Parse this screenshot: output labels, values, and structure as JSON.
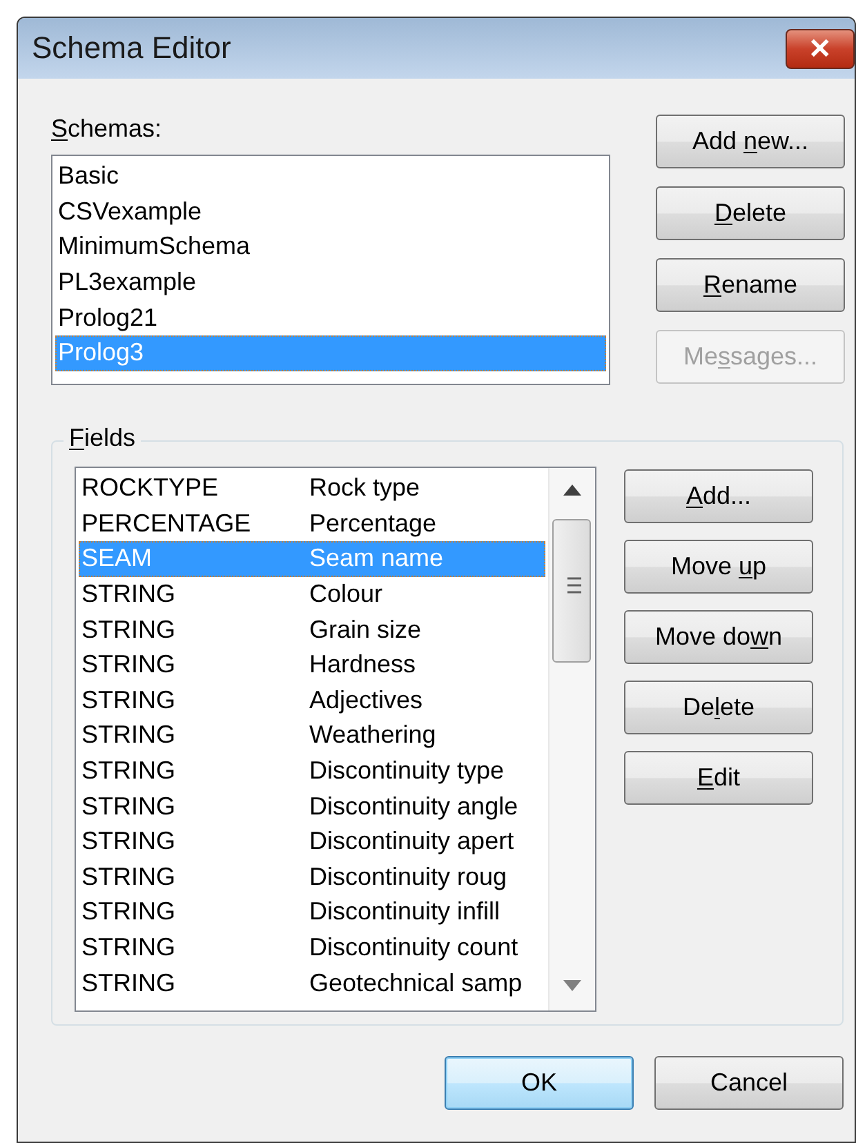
{
  "window": {
    "title": "Schema Editor",
    "close": "✕"
  },
  "schemas": {
    "label": {
      "key": "S",
      "post": "chemas:"
    },
    "items": [
      {
        "name": "Basic",
        "selected": false
      },
      {
        "name": "CSVexample",
        "selected": false
      },
      {
        "name": "MinimumSchema",
        "selected": false
      },
      {
        "name": "PL3example",
        "selected": false
      },
      {
        "name": "Prolog21",
        "selected": false
      },
      {
        "name": "Prolog3",
        "selected": true
      }
    ],
    "buttons": [
      {
        "pre": "Add ",
        "key": "n",
        "post": "ew...",
        "disabled": false
      },
      {
        "key": "D",
        "post": "elete",
        "disabled": false
      },
      {
        "key": "R",
        "post": "ename",
        "disabled": false
      },
      {
        "pre": "Me",
        "key": "s",
        "post": "sages...",
        "disabled": true
      }
    ]
  },
  "fields": {
    "label": {
      "key": "F",
      "post": "ields"
    },
    "rows": [
      {
        "type": "ROCKTYPE",
        "name": "Rock type",
        "selected": false
      },
      {
        "type": "PERCENTAGE",
        "name": "Percentage",
        "selected": false
      },
      {
        "type": "SEAM",
        "name": "Seam name",
        "selected": true
      },
      {
        "type": "STRING",
        "name": "Colour",
        "selected": false
      },
      {
        "type": "STRING",
        "name": "Grain size",
        "selected": false
      },
      {
        "type": "STRING",
        "name": "Hardness",
        "selected": false
      },
      {
        "type": "STRING",
        "name": "Adjectives",
        "selected": false
      },
      {
        "type": "STRING",
        "name": "Weathering",
        "selected": false
      },
      {
        "type": "STRING",
        "name": "Discontinuity type",
        "selected": false
      },
      {
        "type": "STRING",
        "name": "Discontinuity angle",
        "selected": false
      },
      {
        "type": "STRING",
        "name": "Discontinuity apert",
        "selected": false
      },
      {
        "type": "STRING",
        "name": "Discontinuity roug",
        "selected": false
      },
      {
        "type": "STRING",
        "name": "Discontinuity infill",
        "selected": false
      },
      {
        "type": "STRING",
        "name": "Discontinuity count",
        "selected": false
      },
      {
        "type": "STRING",
        "name": "Geotechnical samp",
        "selected": false
      }
    ],
    "buttons": [
      {
        "key": "A",
        "post": "dd...",
        "disabled": false
      },
      {
        "pre": "Move ",
        "key": "u",
        "post": "p",
        "disabled": false
      },
      {
        "pre": "Move do",
        "key": "w",
        "post": "n",
        "disabled": false
      },
      {
        "pre": "De",
        "key": "l",
        "post": "ete",
        "disabled": false
      },
      {
        "key": "E",
        "post": "dit",
        "disabled": false
      }
    ]
  },
  "footer": [
    {
      "label": "OK",
      "default": true
    },
    {
      "label": "Cancel",
      "default": false
    }
  ]
}
